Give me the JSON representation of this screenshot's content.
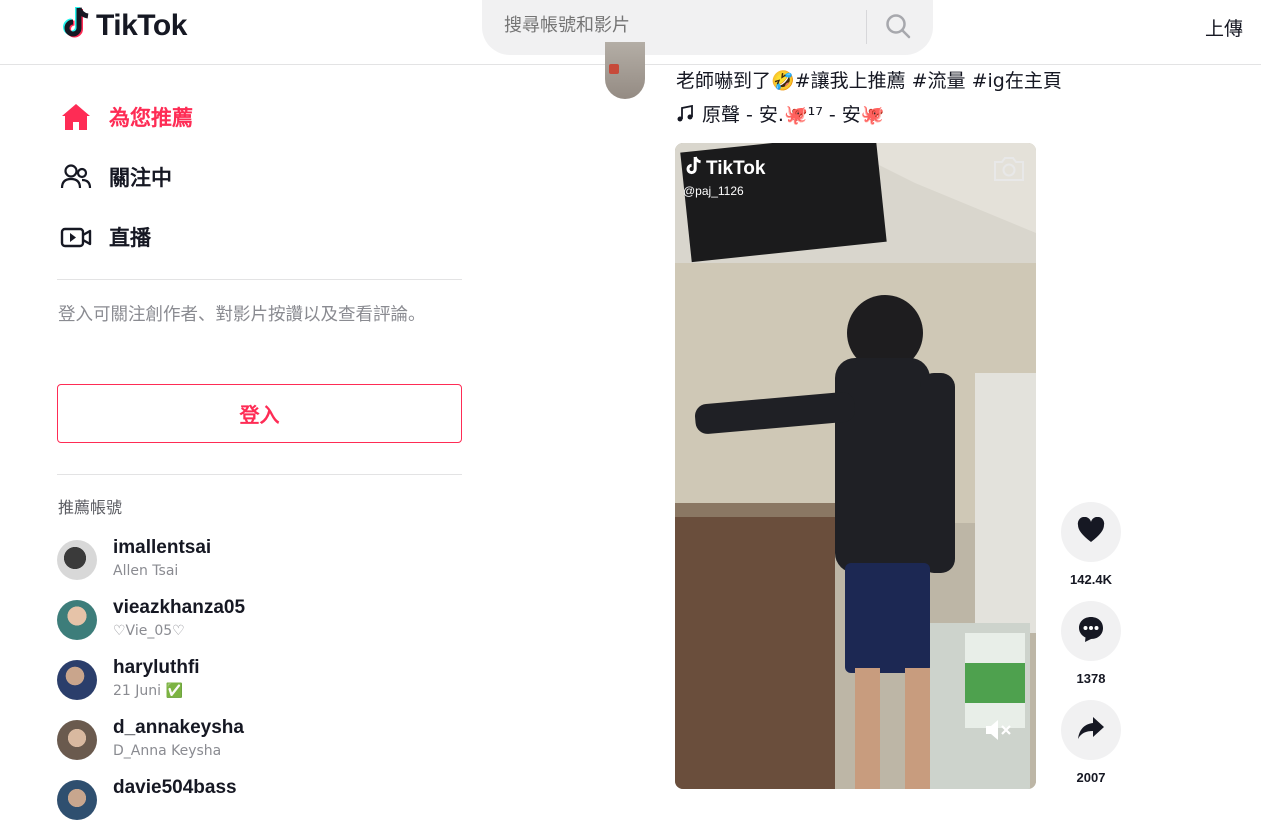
{
  "header": {
    "logo_text": "TikTok",
    "search_placeholder": "搜尋帳號和影片",
    "upload_label": "上傳"
  },
  "sidebar": {
    "nav": [
      {
        "label": "為您推薦",
        "icon": "home-icon",
        "active": true
      },
      {
        "label": "關注中",
        "icon": "users-icon",
        "active": false
      },
      {
        "label": "直播",
        "icon": "live-video-icon",
        "active": false
      }
    ],
    "login_hint": "登入可關注創作者、對影片按讚以及查看評論。",
    "login_button": "登入",
    "suggested_title": "推薦帳號",
    "accounts": [
      {
        "username": "imallentsai",
        "nickname": "Allen Tsai"
      },
      {
        "username": "vieazkhanza05",
        "nickname": "♡Vie_05♡"
      },
      {
        "username": "haryluthfi",
        "nickname": "21 Juni ✅"
      },
      {
        "username": "d_annakeysha",
        "nickname": "D_Anna Keysha"
      },
      {
        "username": "davie504bass",
        "nickname": ""
      }
    ]
  },
  "post": {
    "caption": "老師嚇到了🤣#讓我上推薦 #流量 #ig在主頁",
    "music": "原聲 - 安.🐙¹⁷ - 安🐙",
    "watermark_text": "TikTok",
    "watermark_user": "@paj_1126",
    "actions": {
      "likes": "142.4K",
      "comments": "1378",
      "shares": "2007"
    }
  },
  "colors": {
    "brand": "#fe2c55",
    "text": "#161823",
    "muted": "#8a8b91",
    "button_bg": "#f1f1f2"
  }
}
